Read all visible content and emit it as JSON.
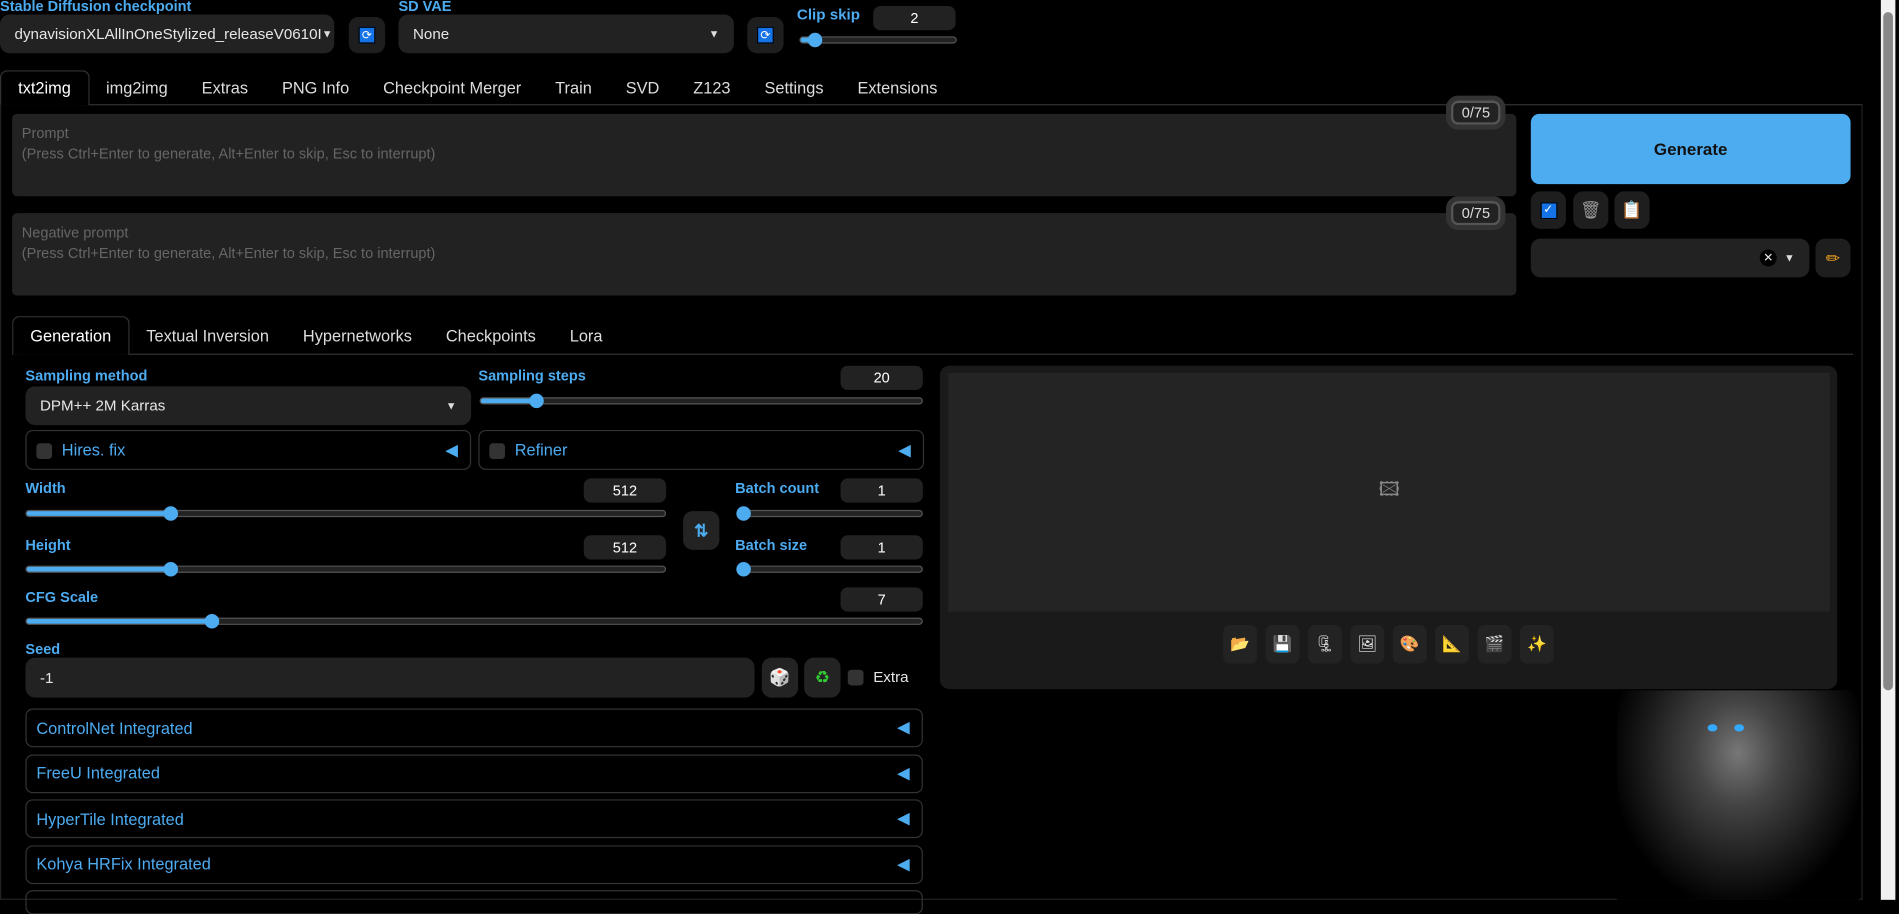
{
  "top": {
    "checkpoint": {
      "label": "Stable Diffusion checkpoint",
      "value": "dynavisionXLAllInOneStylized_releaseV0610I"
    },
    "vae": {
      "label": "SD VAE",
      "value": "None"
    },
    "clip_skip": {
      "label": "Clip skip",
      "value": "2",
      "num": 2,
      "min": 1,
      "max": 12
    }
  },
  "tabs": [
    "txt2img",
    "img2img",
    "Extras",
    "PNG Info",
    "Checkpoint Merger",
    "Train",
    "SVD",
    "Z123",
    "Settings",
    "Extensions"
  ],
  "prompt": {
    "placeholder": "Prompt\n(Press Ctrl+Enter to generate, Alt+Enter to skip, Esc to interrupt)",
    "count": "0/75"
  },
  "negative": {
    "placeholder": "Negative prompt\n(Press Ctrl+Enter to generate, Alt+Enter to skip, Esc to interrupt)",
    "count": "0/75"
  },
  "generate": "Generate",
  "subtabs": [
    "Generation",
    "Textual Inversion",
    "Hypernetworks",
    "Checkpoints",
    "Lora"
  ],
  "gen": {
    "sampling_method": {
      "label": "Sampling method",
      "value": "DPM++ 2M Karras"
    },
    "sampling_steps": {
      "label": "Sampling steps",
      "value": "20",
      "num": 20,
      "min": 1,
      "max": 150
    },
    "hires": "Hires. fix",
    "refiner": "Refiner",
    "width": {
      "label": "Width",
      "value": "512",
      "num": 512,
      "min": 64,
      "max": 2048
    },
    "height": {
      "label": "Height",
      "value": "512",
      "num": 512,
      "min": 64,
      "max": 2048
    },
    "batch_count": {
      "label": "Batch count",
      "value": "1",
      "num": 1,
      "min": 1,
      "max": 100
    },
    "batch_size": {
      "label": "Batch size",
      "value": "1",
      "num": 1,
      "min": 1,
      "max": 8
    },
    "cfg": {
      "label": "CFG Scale",
      "value": "7",
      "num": 7,
      "min": 1,
      "max": 30
    },
    "seed": {
      "label": "Seed",
      "value": "-1",
      "extra": "Extra"
    },
    "accordions": [
      "ControlNet Integrated",
      "FreeU Integrated",
      "HyperTile Integrated",
      "Kohya HRFix Integrated"
    ]
  },
  "output_tools": [
    "📂",
    "💾",
    "🗜",
    "🖼",
    "🎨",
    "📐",
    "🎬",
    "✨"
  ],
  "colors": {
    "accent": "#4dabf0",
    "background": "#000000",
    "panel": "#222222"
  }
}
